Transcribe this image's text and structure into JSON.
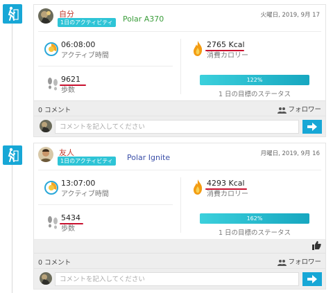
{
  "colors": {
    "accent": "#17a7d6",
    "badge": "#2ec4d6",
    "username": "#c0392b",
    "underline": "#c8102e"
  },
  "posts": [
    {
      "user_name": "自分",
      "badge": "1日のアクティビティ",
      "device": "Polar A370",
      "device_color": "#3a9d3a",
      "date": "火曜日, 2019, 9月 17",
      "active_time": "06:08:00",
      "active_label": "アクティブ時間",
      "calories": "2765 Kcal",
      "calories_label": "消費カロリー",
      "steps": "9621",
      "steps_label": "歩数",
      "goal_progress": "122%",
      "goal_fraction": 1.0,
      "goal_label": "1 日の目標のステータス",
      "comment_count": "0 コメント",
      "follow_label": "フォロワー",
      "comment_placeholder": "コメントを記入してください"
    },
    {
      "user_name": "友人",
      "badge": "1日のアクティビティ",
      "device": "Polar Ignite",
      "device_color": "#3b4fa8",
      "date": "月曜日, 2019, 9月 16",
      "active_time": "13:07:00",
      "active_label": "アクティブ時間",
      "calories": "4293 Kcal",
      "calories_label": "消費カロリー",
      "steps": "5434",
      "steps_label": "歩数",
      "goal_progress": "162%",
      "goal_fraction": 1.0,
      "goal_label": "1 日の目標のステータス",
      "comment_count": "0 コメント",
      "follow_label": "フォロワー",
      "comment_placeholder": "コメントを記入してください"
    }
  ]
}
